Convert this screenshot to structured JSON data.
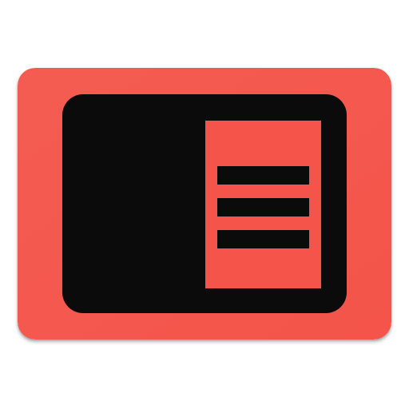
{
  "icon": {
    "name": "reader-panel-icon",
    "colors": {
      "background": "#f4544a",
      "background_light": "#f45c52",
      "screen": "#0b0b0b",
      "panel": "#f4544a",
      "lines": "#0b0b0b"
    },
    "glyphs": [
      "tablet-screen",
      "side-panel",
      "menu-lines"
    ],
    "menu_line_count": 3
  }
}
